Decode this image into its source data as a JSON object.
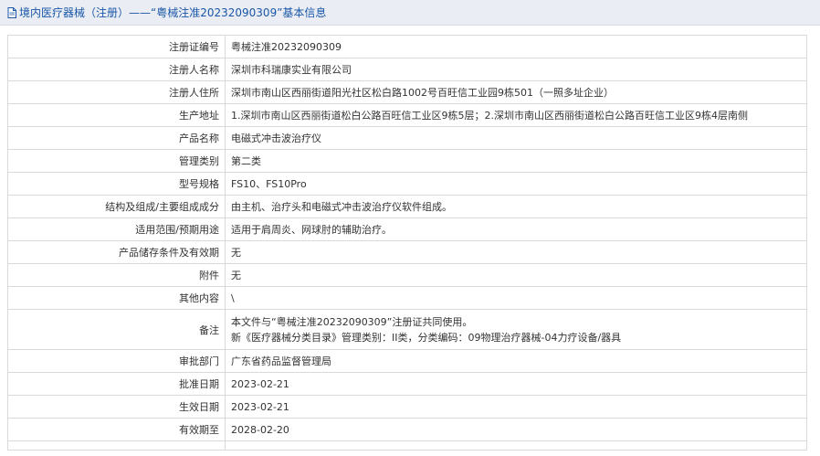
{
  "header": {
    "title": "境内医疗器械（注册）——“粤械注准20232090309”基本信息"
  },
  "rows": [
    {
      "label": "注册证编号",
      "value": "粤械注准20232090309"
    },
    {
      "label": "注册人名称",
      "value": "深圳市科瑞康实业有限公司"
    },
    {
      "label": "注册人住所",
      "value": "深圳市南山区西丽街道阳光社区松白路1002号百旺信工业园9栋501（一照多址企业）"
    },
    {
      "label": "生产地址",
      "value": "1.深圳市南山区西丽街道松白公路百旺信工业区9栋5层；2.深圳市南山区西丽街道松白公路百旺信工业区9栋4层南侧"
    },
    {
      "label": "产品名称",
      "value": "电磁式冲击波治疗仪"
    },
    {
      "label": "管理类别",
      "value": "第二类"
    },
    {
      "label": "型号规格",
      "value": "FS10、FS10Pro"
    },
    {
      "label": "结构及组成/主要组成成分",
      "value": "由主机、治疗头和电磁式冲击波治疗仪软件组成。"
    },
    {
      "label": "适用范围/预期用途",
      "value": "适用于肩周炎、网球肘的辅助治疗。"
    },
    {
      "label": "产品储存条件及有效期",
      "value": "无"
    },
    {
      "label": "附件",
      "value": "无"
    },
    {
      "label": "其他内容",
      "value": "\\"
    },
    {
      "label": "备注",
      "value_line1": "本文件与“粤械注准20232090309”注册证共同使用。",
      "value_line2": "新《医疗器械分类目录》管理类别：II类，分类编码：09物理治疗器械-04力疗设备/器具"
    },
    {
      "label": "审批部门",
      "value": "广东省药品监督管理局"
    },
    {
      "label": "批准日期",
      "value": "2023-02-21"
    },
    {
      "label": "生效日期",
      "value": "2023-02-21"
    },
    {
      "label": "有效期至",
      "value": "2028-02-20"
    }
  ],
  "colors": {
    "header_bg": "#eaeef4",
    "header_text": "#1a56a8",
    "border": "#d9d9d9"
  },
  "icons": {
    "header_icon": "document-icon"
  }
}
